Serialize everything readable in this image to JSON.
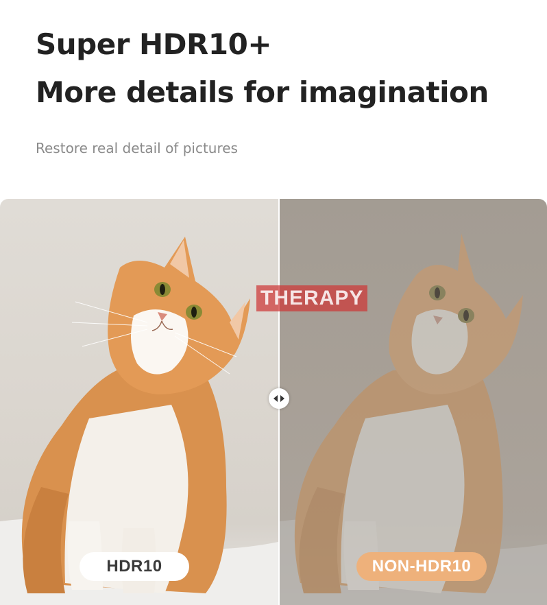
{
  "header": {
    "title_line1": "Super HDR10+",
    "title_line2": "More details for imagination",
    "subtitle": "Restore real detail of pictures"
  },
  "comparison": {
    "left_label": "HDR10",
    "right_label": "NON-HDR10",
    "handle_icon": "left-right-arrows-icon"
  },
  "watermark": {
    "text": "THERAPY"
  },
  "colors": {
    "title": "#222222",
    "subtitle": "#8a8a8a",
    "hdr_label_bg": "#ffffff",
    "non_hdr_label_bg": "#eeb17b",
    "watermark_bg": "#cd3737"
  }
}
